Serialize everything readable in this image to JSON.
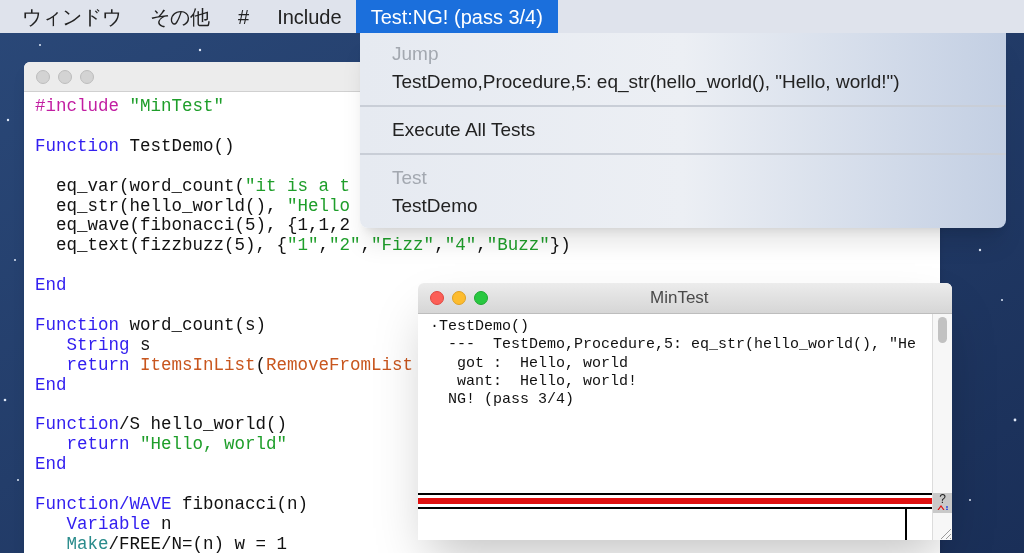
{
  "menu_bar": {
    "items": [
      {
        "label": "ウィンドウ",
        "selected": false
      },
      {
        "label": "その他",
        "selected": false
      },
      {
        "label": "#",
        "selected": false
      },
      {
        "label": "Include",
        "selected": false
      },
      {
        "label": "Test:NG! (pass 3/4)",
        "selected": true
      }
    ]
  },
  "menu": {
    "entries": [
      {
        "kind": "header",
        "label": "Jump"
      },
      {
        "kind": "item",
        "label": "TestDemo,Procedure,5: eq_str(hello_world(), \"Hello, world!\")"
      },
      {
        "kind": "separator"
      },
      {
        "kind": "item",
        "label": "Execute All Tests"
      },
      {
        "kind": "separator"
      },
      {
        "kind": "header",
        "label": "Test"
      },
      {
        "kind": "item",
        "label": "TestDemo"
      }
    ]
  },
  "editor_window": {
    "active": false,
    "lines": [
      {
        "kind": "code",
        "segments": [
          {
            "kind": "preproc",
            "text": "#include "
          },
          {
            "kind": "string",
            "text": "\"MinTest\""
          }
        ]
      },
      {
        "kind": "blank"
      },
      {
        "kind": "code",
        "segments": [
          {
            "kind": "keyword",
            "text": "Function"
          },
          {
            "kind": "plain",
            "text": " TestDemo()"
          }
        ]
      },
      {
        "kind": "blank"
      },
      {
        "kind": "code",
        "segments": [
          {
            "kind": "plain",
            "text": "  eq_var(word_count("
          },
          {
            "kind": "string",
            "text": "\"it is a t"
          }
        ]
      },
      {
        "kind": "code",
        "segments": [
          {
            "kind": "plain",
            "text": "  eq_str(hello_world(), "
          },
          {
            "kind": "string",
            "text": "\"Hello"
          }
        ]
      },
      {
        "kind": "code",
        "segments": [
          {
            "kind": "plain",
            "text": "  eq_wave(fibonacci(5), {1,1,2"
          }
        ]
      },
      {
        "kind": "code",
        "segments": [
          {
            "kind": "plain",
            "text": "  eq_text(fizzbuzz(5), {"
          },
          {
            "kind": "string",
            "text": "\"1\""
          },
          {
            "kind": "plain",
            "text": ","
          },
          {
            "kind": "string",
            "text": "\"2\""
          },
          {
            "kind": "plain",
            "text": ","
          },
          {
            "kind": "string",
            "text": "\"Fizz\""
          },
          {
            "kind": "plain",
            "text": ","
          },
          {
            "kind": "string",
            "text": "\"4\""
          },
          {
            "kind": "plain",
            "text": ","
          },
          {
            "kind": "string",
            "text": "\"Buzz\""
          },
          {
            "kind": "plain",
            "text": "})"
          }
        ]
      },
      {
        "kind": "blank"
      },
      {
        "kind": "code",
        "segments": [
          {
            "kind": "keyword",
            "text": "End"
          }
        ]
      },
      {
        "kind": "blank"
      },
      {
        "kind": "code",
        "segments": [
          {
            "kind": "keyword",
            "text": "Function"
          },
          {
            "kind": "plain",
            "text": " word_count(s)"
          }
        ]
      },
      {
        "kind": "code",
        "segments": [
          {
            "kind": "keyword",
            "text": "   String"
          },
          {
            "kind": "plain",
            "text": " s"
          }
        ]
      },
      {
        "kind": "code",
        "segments": [
          {
            "kind": "keyword",
            "text": "   return "
          },
          {
            "kind": "builtin",
            "text": "ItemsInList"
          },
          {
            "kind": "plain",
            "text": "("
          },
          {
            "kind": "builtin",
            "text": "RemoveFromList"
          }
        ]
      },
      {
        "kind": "code",
        "segments": [
          {
            "kind": "keyword",
            "text": "End"
          }
        ]
      },
      {
        "kind": "blank"
      },
      {
        "kind": "code",
        "segments": [
          {
            "kind": "keyword",
            "text": "Function"
          },
          {
            "kind": "plain",
            "text": "/S hello_world()"
          }
        ]
      },
      {
        "kind": "code",
        "segments": [
          {
            "kind": "keyword",
            "text": "   return "
          },
          {
            "kind": "string",
            "text": "\"Hello, world\""
          }
        ]
      },
      {
        "kind": "code",
        "segments": [
          {
            "kind": "keyword",
            "text": "End"
          }
        ]
      },
      {
        "kind": "blank"
      },
      {
        "kind": "code",
        "segments": [
          {
            "kind": "keyword",
            "text": "Function/WAVE"
          },
          {
            "kind": "plain",
            "text": " fibonacci(n)"
          }
        ]
      },
      {
        "kind": "code",
        "segments": [
          {
            "kind": "keyword",
            "text": "   Variable"
          },
          {
            "kind": "plain",
            "text": " n"
          }
        ]
      },
      {
        "kind": "code",
        "segments": [
          {
            "kind": "operation",
            "text": "   Make"
          },
          {
            "kind": "plain",
            "text": "/FREE/N=(n) w = 1"
          }
        ]
      }
    ]
  },
  "output_window": {
    "active": true,
    "title": "MinTest",
    "lines": [
      "·TestDemo()",
      "  ---  TestDemo,Procedure,5: eq_str(hello_world(), \"He",
      "   got :  Hello, world",
      "   want:  Hello, world!",
      "  NG! (pass 3/4)"
    ],
    "help_glyph": "?"
  }
}
